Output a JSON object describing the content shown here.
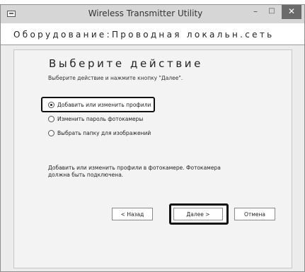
{
  "window": {
    "title": "Wireless Transmitter Utility",
    "min_glyph": "–",
    "max_glyph": "□",
    "close_glyph": "✕"
  },
  "header": {
    "text": "Оборудование:Проводная локальн.сеть"
  },
  "page": {
    "title": "Выберите действие",
    "subtitle": "Выберите действие и нажмите кнопку \"Далее\".",
    "options": [
      {
        "label": "Добавить или изменить профили",
        "selected": true
      },
      {
        "label": "Изменить пароль фотокамеры",
        "selected": false
      },
      {
        "label": "Выбрать папку для изображений",
        "selected": false
      }
    ],
    "description": "Добавить или изменить профили в фотокамере. Фотокамера должна быть подключена."
  },
  "buttons": {
    "back": "< Назад",
    "next": "Далее >",
    "cancel": "Отмена"
  }
}
